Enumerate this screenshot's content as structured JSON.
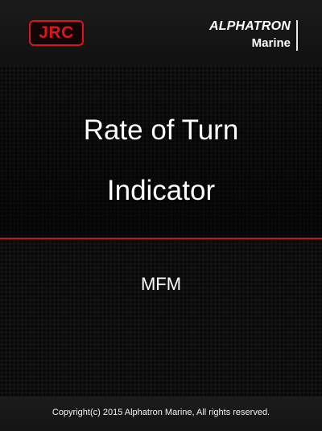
{
  "header": {
    "left_logo_text": "JRC",
    "right_logo_line1": "ALPHATRON",
    "right_logo_line2": "Marine"
  },
  "title": {
    "line1": "Rate of Turn",
    "line2": "Indicator"
  },
  "model": "MFM",
  "footer": {
    "copyright": "Copyright(c) 2015 Alphatron Marine, All rights reserved."
  },
  "colors": {
    "accent_red": "#c8141c",
    "jrc_red": "#e0141c",
    "background": "#0d0d0d",
    "text": "#ffffff"
  }
}
